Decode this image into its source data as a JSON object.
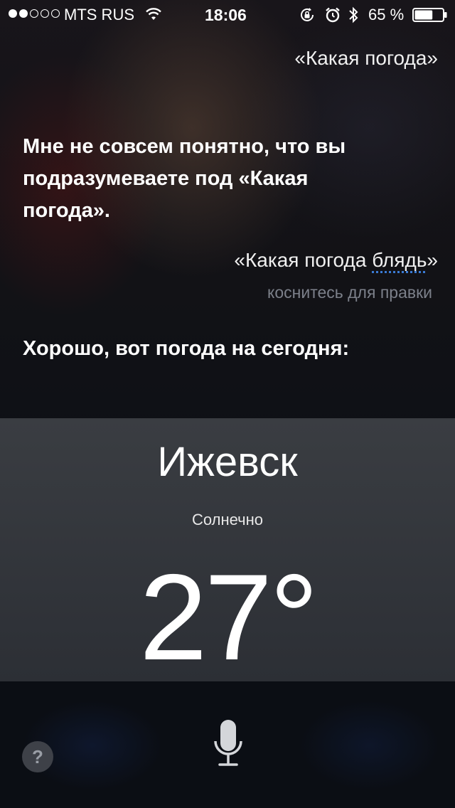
{
  "status_bar": {
    "carrier": "MTS RUS",
    "time": "18:06",
    "battery_percent": "65 %",
    "battery_level": 0.65,
    "signal_bars_filled": 2,
    "signal_bars_total": 5
  },
  "conversation": {
    "user_query_1": "«Какая погода»",
    "siri_reply_1": "Мне не совсем понятно, что вы подразумеваете под «Какая погода».",
    "user_query_2_prefix": "«Какая погода ",
    "user_query_2_word": "блядь",
    "user_query_2_suffix": "»",
    "tap_to_edit": "коснитесь для правки",
    "siri_reply_2": "Хорошо, вот погода на сегодня:"
  },
  "weather": {
    "city": "Ижевск",
    "condition": "Солнечно",
    "temperature": "27°"
  },
  "bottom_bar": {
    "help_label": "?"
  },
  "icons": {
    "wifi": "wifi-icon",
    "rotation_lock": "rotation-lock-icon",
    "alarm": "alarm-icon",
    "bluetooth": "bluetooth-icon",
    "battery": "battery-icon",
    "microphone": "microphone-icon",
    "help": "question-icon"
  }
}
